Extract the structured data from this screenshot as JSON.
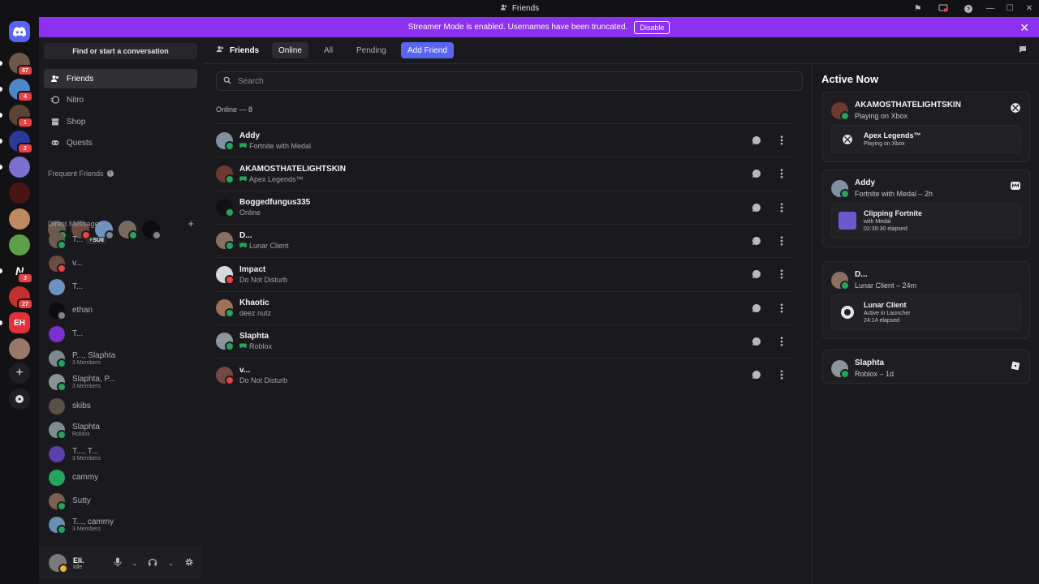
{
  "window": {
    "title": "Friends"
  },
  "banner": {
    "text": "Streamer Mode is enabled. Usernames have been truncated.",
    "button": "Disable"
  },
  "guild_badges": [
    "87",
    "4",
    "1",
    "2",
    "3",
    "27"
  ],
  "sidebar": {
    "find_label": "Find or start a conversation",
    "nav": [
      {
        "label": "Friends",
        "icon": "friends-icon"
      },
      {
        "label": "Nitro",
        "icon": "nitro-icon"
      },
      {
        "label": "Shop",
        "icon": "shop-icon"
      },
      {
        "label": "Quests",
        "icon": "quests-icon"
      }
    ],
    "frequent_title": "Frequent Friends",
    "dm_title": "Direct Messages",
    "dms": [
      {
        "name": "T...",
        "sub": "",
        "tag": "⚡SUII",
        "status": "online",
        "color": "#6b5a4e"
      },
      {
        "name": "v...",
        "sub": "",
        "tag": "",
        "status": "dnd",
        "color": "#6e4a40"
      },
      {
        "name": "T...",
        "sub": "",
        "tag": "",
        "status": "",
        "color": "#6f90c0"
      },
      {
        "name": "ethan",
        "sub": "",
        "tag": "",
        "status": "off",
        "color": "#0c0c0c"
      },
      {
        "name": "T...",
        "sub": "",
        "tag": "",
        "status": "",
        "color": "#7a2fd0"
      },
      {
        "name": "P..., Slaphta",
        "sub": "3 Members",
        "tag": "",
        "status": "online",
        "color": "#7b8a90"
      },
      {
        "name": "Slaphta, P...",
        "sub": "3 Members",
        "tag": "",
        "status": "online",
        "color": "#8a9298"
      },
      {
        "name": "skibs",
        "sub": "",
        "tag": "",
        "status": "",
        "color": "#5a5048"
      },
      {
        "name": "Slaphta",
        "sub": "Roblox",
        "tag": "",
        "status": "online",
        "color": "#7f8c92"
      },
      {
        "name": "T..., T...",
        "sub": "3 Members",
        "tag": "",
        "status": "",
        "color": "#5d3fb0"
      },
      {
        "name": "cammy",
        "sub": "",
        "tag": "",
        "status": "",
        "color": "#23a55a"
      },
      {
        "name": "Sutty",
        "sub": "",
        "tag": "",
        "status": "online",
        "color": "#7a6250"
      },
      {
        "name": "T..., cammy",
        "sub": "3 Members",
        "tag": "",
        "status": "online",
        "color": "#6a8fb0"
      }
    ]
  },
  "user": {
    "name": "Eli.",
    "status": "Idle"
  },
  "header": {
    "title": "Friends",
    "tabs": [
      "Online",
      "All",
      "Pending"
    ],
    "add_friend": "Add Friend"
  },
  "search": {
    "placeholder": "Search"
  },
  "online_count": "Online — 8",
  "friends": [
    {
      "name": "Addy",
      "activity": "Fortnite with Medal",
      "game": true,
      "status": "online",
      "color": "#8090a0"
    },
    {
      "name": "AKAMOSTHATELIGHTSKIN",
      "activity": "Apex Legends™",
      "game": true,
      "status": "online",
      "color": "#6e3a30"
    },
    {
      "name": "Boggedfungus335",
      "activity": "Online",
      "game": false,
      "status": "online",
      "color": "#111111"
    },
    {
      "name": "D...",
      "activity": "Lunar Client",
      "game": true,
      "status": "online",
      "color": "#8a7060"
    },
    {
      "name": "Impact",
      "activity": "Do Not Disturb",
      "game": false,
      "status": "dnd",
      "color": "#d8d8d8"
    },
    {
      "name": "Khaotic",
      "activity": "deez nutz",
      "game": false,
      "status": "online",
      "color": "#a0705a"
    },
    {
      "name": "Slaphta",
      "activity": "Roblox",
      "game": true,
      "status": "online",
      "color": "#8a969c"
    },
    {
      "name": "v...",
      "activity": "Do Not Disturb",
      "game": false,
      "status": "dnd",
      "color": "#6e4a40"
    }
  ],
  "active_now": {
    "title": "Active Now",
    "cards": [
      {
        "name": "AKAMOSTHATELIGHTSKIN",
        "sub": "Playing on Xbox",
        "badge": "xbox-icon",
        "color": "#6e3a30",
        "inner": {
          "name": "Apex Legends™",
          "lines": [
            "Playing on Xbox"
          ],
          "icon": "xbox-icon"
        }
      },
      {
        "name": "Addy",
        "sub": "Fortnite with Medal – 2h",
        "badge": "medal-icon",
        "color": "#8090a0",
        "inner": {
          "name": "Clipping Fortnite",
          "lines": [
            "with Medal",
            "02:39:30 elapsed"
          ],
          "icon": "fortnite-icon"
        }
      },
      {
        "name": "D...",
        "sub": "Lunar Client – 24m",
        "badge": "",
        "color": "#8a7060",
        "inner": {
          "name": "Lunar Client",
          "lines": [
            "Active in Launcher",
            "24:14 elapsed"
          ],
          "icon": "lunar-icon"
        }
      },
      {
        "name": "Slaphta",
        "sub": "Roblox – 1d",
        "badge": "roblox-icon",
        "color": "#8a969c",
        "inner": null
      }
    ]
  }
}
